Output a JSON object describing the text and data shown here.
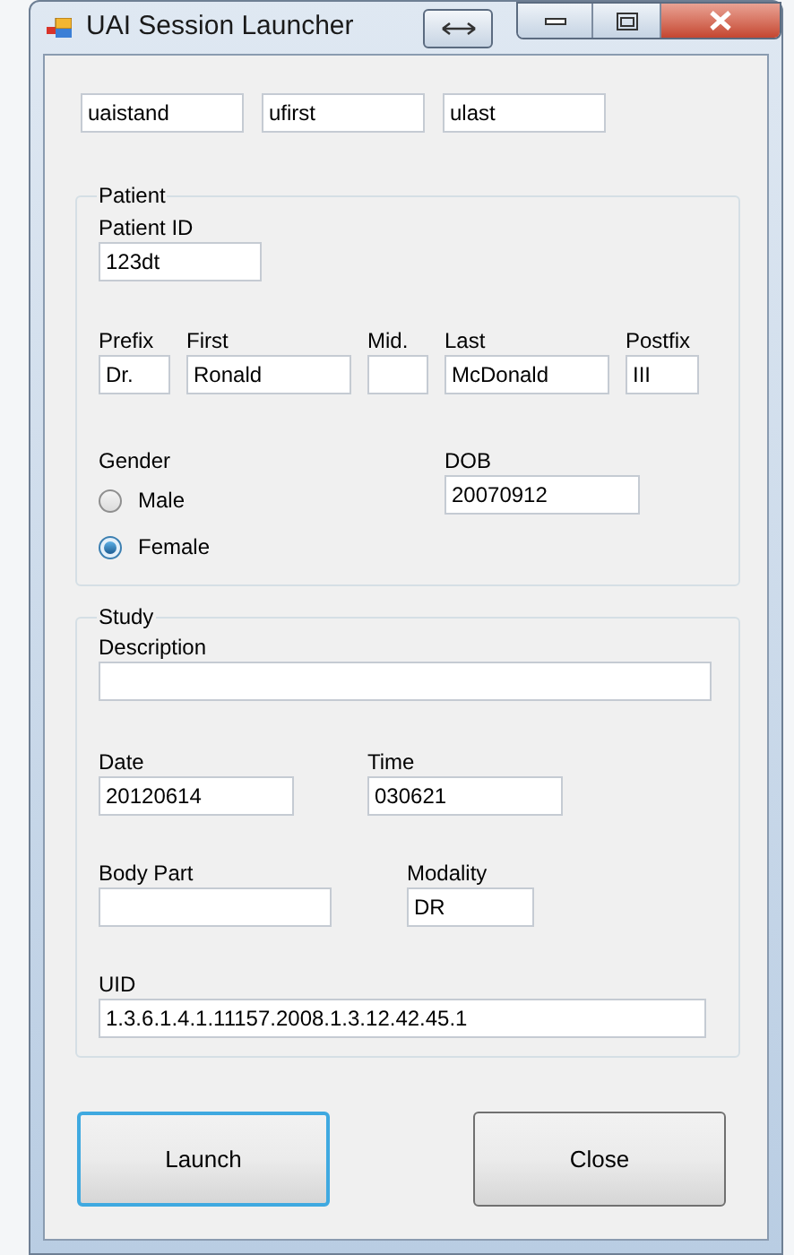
{
  "window": {
    "title": "UAI Session Launcher"
  },
  "top_fields": [
    {
      "value": "uaistand"
    },
    {
      "value": "ufirst"
    },
    {
      "value": "ulast"
    }
  ],
  "patient": {
    "title": "Patient",
    "patient_id": {
      "label": "Patient ID",
      "value": "123dt"
    },
    "name_fields": [
      {
        "label": "Prefix",
        "value": "Dr."
      },
      {
        "label": "First",
        "value": "Ronald"
      },
      {
        "label": "Mid."
      },
      {
        "label": "Last",
        "value": "McDonald"
      },
      {
        "label": "Postfix",
        "value": "III"
      }
    ],
    "gender": {
      "label": "Gender",
      "options": [
        {
          "label": "Male",
          "selected": false
        },
        {
          "label": "Female",
          "selected": true
        }
      ]
    },
    "dob": {
      "label": "DOB",
      "value": "20070912"
    }
  },
  "study": {
    "title": "Study",
    "rows": [
      [
        {
          "label": "Description"
        }
      ],
      [
        {
          "label": "Date",
          "value": "20120614"
        },
        {
          "label": "Time",
          "value": "030621"
        }
      ],
      [
        {
          "label": "Body Part"
        },
        {
          "label": "Modality",
          "value": "DR"
        }
      ],
      [
        {
          "label": "UID",
          "value": "1.3.6.1.4.1.11157.2008.1.3.12.42.45.1"
        }
      ]
    ]
  },
  "buttons": [
    {
      "label": "Launch",
      "focused": true
    },
    {
      "label": "Close",
      "focused": false
    }
  ]
}
